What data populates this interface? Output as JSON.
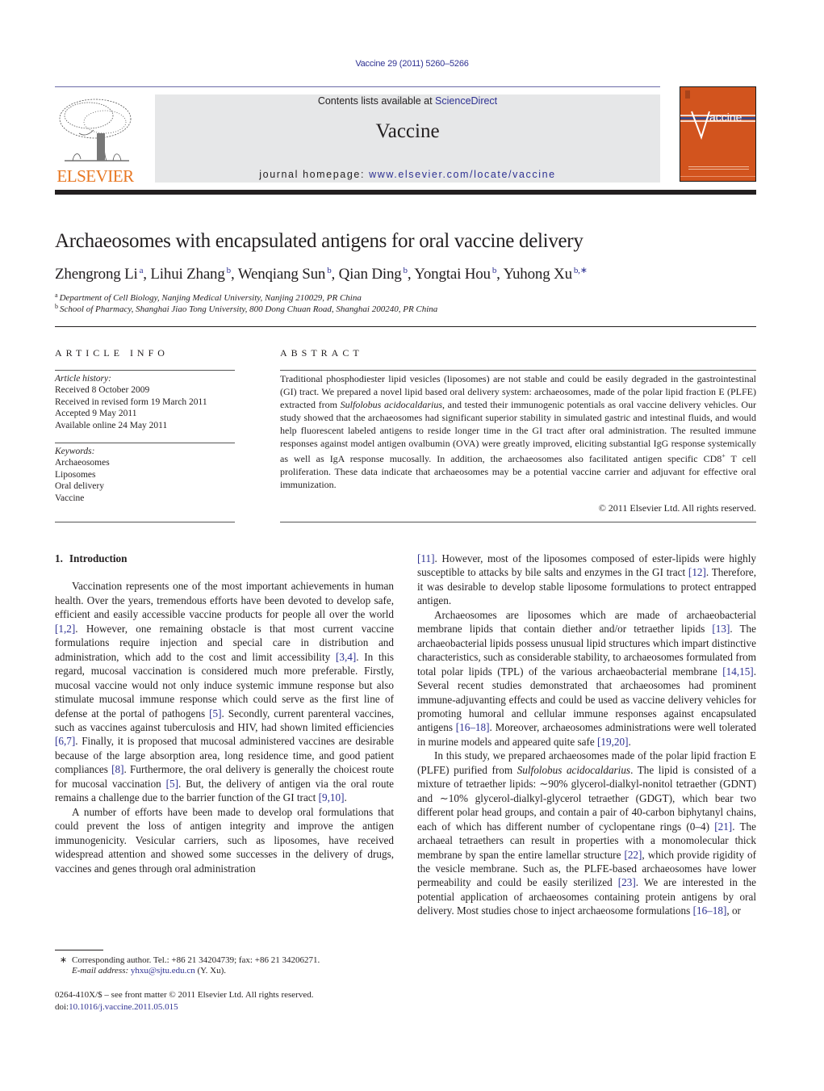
{
  "header": {
    "journal_ref": "Vaccine 29 (2011) 5260–5266",
    "contents_prefix": "Contents lists available at ",
    "contents_link": "ScienceDirect",
    "journal_title": "Vaccine",
    "homepage_prefix": "journal homepage: ",
    "homepage_link": "www.elsevier.com/locate/vaccine",
    "publisher_logo_text": "ELSEVIER",
    "cover_title": "Vaccine",
    "colors": {
      "brand_orange": "#e87722",
      "cover_orange": "#d2541e",
      "link_blue": "#2e3192",
      "masthead_gray": "#e6e7e8"
    }
  },
  "article": {
    "title": "Archaeosomes with encapsulated antigens for oral vaccine delivery",
    "authors": [
      {
        "name": "Zhengrong Li",
        "sup": "a"
      },
      {
        "name": "Lihui Zhang",
        "sup": "b"
      },
      {
        "name": "Wenqiang Sun",
        "sup": "b"
      },
      {
        "name": "Qian Ding",
        "sup": "b"
      },
      {
        "name": "Yongtai Hou",
        "sup": "b"
      },
      {
        "name": "Yuhong Xu",
        "sup": "b,∗"
      }
    ],
    "affiliations": [
      {
        "key": "a",
        "text": "Department of Cell Biology, Nanjing Medical University, Nanjing 210029, PR China"
      },
      {
        "key": "b",
        "text": "School of Pharmacy, Shanghai Jiao Tong University, 800 Dong Chuan Road, Shanghai 200240, PR China"
      }
    ]
  },
  "article_info": {
    "heading": "ARTICLE INFO",
    "history_label": "Article history:",
    "history": [
      "Received 8 October 2009",
      "Received in revised form 19 March 2011",
      "Accepted 9 May 2011",
      "Available online 24 May 2011"
    ],
    "keywords_label": "Keywords:",
    "keywords": [
      "Archaeosomes",
      "Liposomes",
      "Oral delivery",
      "Vaccine"
    ]
  },
  "abstract": {
    "heading": "ABSTRACT",
    "text_1": "Traditional phosphodiester lipid vesicles (liposomes) are not stable and could be easily degraded in the gastrointestinal (GI) tract. We prepared a novel lipid based oral delivery system: archaeosomes, made of the polar lipid fraction E (PLFE) extracted from ",
    "species": "Sulfolobus acidocaldarius",
    "text_2": ", and tested their immunogenic potentials as oral vaccine delivery vehicles. Our study showed that the archaeosomes had significant superior stability in simulated gastric and intestinal fluids, and would help fluorescent labeled antigens to reside longer time in the GI tract after oral administration. The resulted immune responses against model antigen ovalbumin (OVA) were greatly improved, eliciting substantial IgG response systemically as well as IgA response mucosally. In addition, the archaeosomes also facilitated antigen specific CD8",
    "sup": "+",
    "text_3": " T cell proliferation. These data indicate that archaeosomes may be a potential vaccine carrier and adjuvant for effective oral immunization.",
    "copyright": "© 2011 Elsevier Ltd. All rights reserved."
  },
  "body": {
    "section_number": "1.",
    "section_title": "Introduction",
    "p1": [
      "Vaccination represents one of the most important achievements in human health. Over the years, tremendous efforts have been devoted to develop safe, efficient and easily accessible vaccine products for people all over the world ",
      "[1,2]",
      ". However, one remaining obstacle is that most current vaccine formulations require injection and special care in distribution and administration, which add to the cost and limit accessibility ",
      "[3,4]",
      ". In this regard, mucosal vaccination is considered much more preferable. Firstly, mucosal vaccine would not only induce systemic immune response but also stimulate mucosal immune response which could serve as the first line of defense at the portal of pathogens ",
      "[5]",
      ". Secondly, current parenteral vaccines, such as vaccines against tuberculosis and HIV, had shown limited efficiencies ",
      "[6,7]",
      ". Finally, it is proposed that mucosal administered vaccines are desirable because of the large absorption area, long residence time, and good patient compliances ",
      "[8]",
      ". Furthermore, the oral delivery is generally the choicest route for mucosal vaccination ",
      "[5]",
      ". But, the delivery of antigen via the oral route remains a challenge due to the barrier function of the GI tract ",
      "[9,10]",
      "."
    ],
    "p2": [
      "A number of efforts have been made to develop oral formulations that could prevent the loss of antigen integrity and improve the antigen immunogenicity. Vesicular carriers, such as liposomes, have received widespread attention and showed some successes in the delivery of drugs, vaccines and genes through oral administration ",
      "[11]",
      ". However, most of the liposomes composed of ester-lipids were highly susceptible to attacks by bile salts and enzymes in the GI tract ",
      "[12]",
      ". Therefore, it was desirable to develop stable liposome formulations to protect entrapped antigen."
    ],
    "p3": [
      "Archaeosomes are liposomes which are made of archaeobacterial membrane lipids that contain diether and/or tetraether lipids ",
      "[13]",
      ". The archaeobacterial lipids possess unusual lipid structures which impart distinctive characteristics, such as considerable stability, to archaeosomes formulated from total polar lipids (TPL) of the various archaeobacterial membrane ",
      "[14,15]",
      ". Several recent studies demonstrated that archaeosomes had prominent immune-adjuvanting effects and could be used as vaccine delivery vehicles for promoting humoral and cellular immune responses against encapsulated antigens ",
      "[16–18]",
      ". Moreover, archaeosomes administrations were well tolerated in murine models and appeared quite safe ",
      "[19,20]",
      "."
    ],
    "p4": [
      "In this study, we prepared archaeosomes made of the polar lipid fraction E (PLFE) purified from ",
      "Sulfolobus acidocaldarius",
      ". The lipid is consisted of a mixture of tetraether lipids: ∼90% glycerol-dialkyl-nonitol tetraether (GDNT) and ∼10% glycerol-dialkyl-glycerol tetraether (GDGT), which bear two different polar head groups, and contain a pair of 40-carbon biphytanyl chains, each of which has different number of cyclopentane rings (0–4) ",
      "[21]",
      ". The archaeal tetraethers can result in properties with a monomolecular thick membrane by span the entire lamellar structure ",
      "[22]",
      ", which provide rigidity of the vesicle membrane. Such as, the PLFE-based archaeosomes have lower permeability and could be easily sterilized ",
      "[23]",
      ". We are interested in the potential application of archaeosomes containing protein antigens by oral delivery. Most studies chose to inject archaeosome formulations ",
      "[16–18]",
      ", or"
    ]
  },
  "footnotes": {
    "star": "∗",
    "corresponding": "Corresponding author. Tel.: +86 21 34204739; fax: +86 21 34206271.",
    "email_label": "E-mail address:",
    "email": "yhxu@sjtu.edu.cn",
    "email_suffix": " (Y. Xu).",
    "issn_line": "0264-410X/$ – see front matter © 2011 Elsevier Ltd. All rights reserved.",
    "doi_prefix": "doi:",
    "doi": "10.1016/j.vaccine.2011.05.015"
  }
}
